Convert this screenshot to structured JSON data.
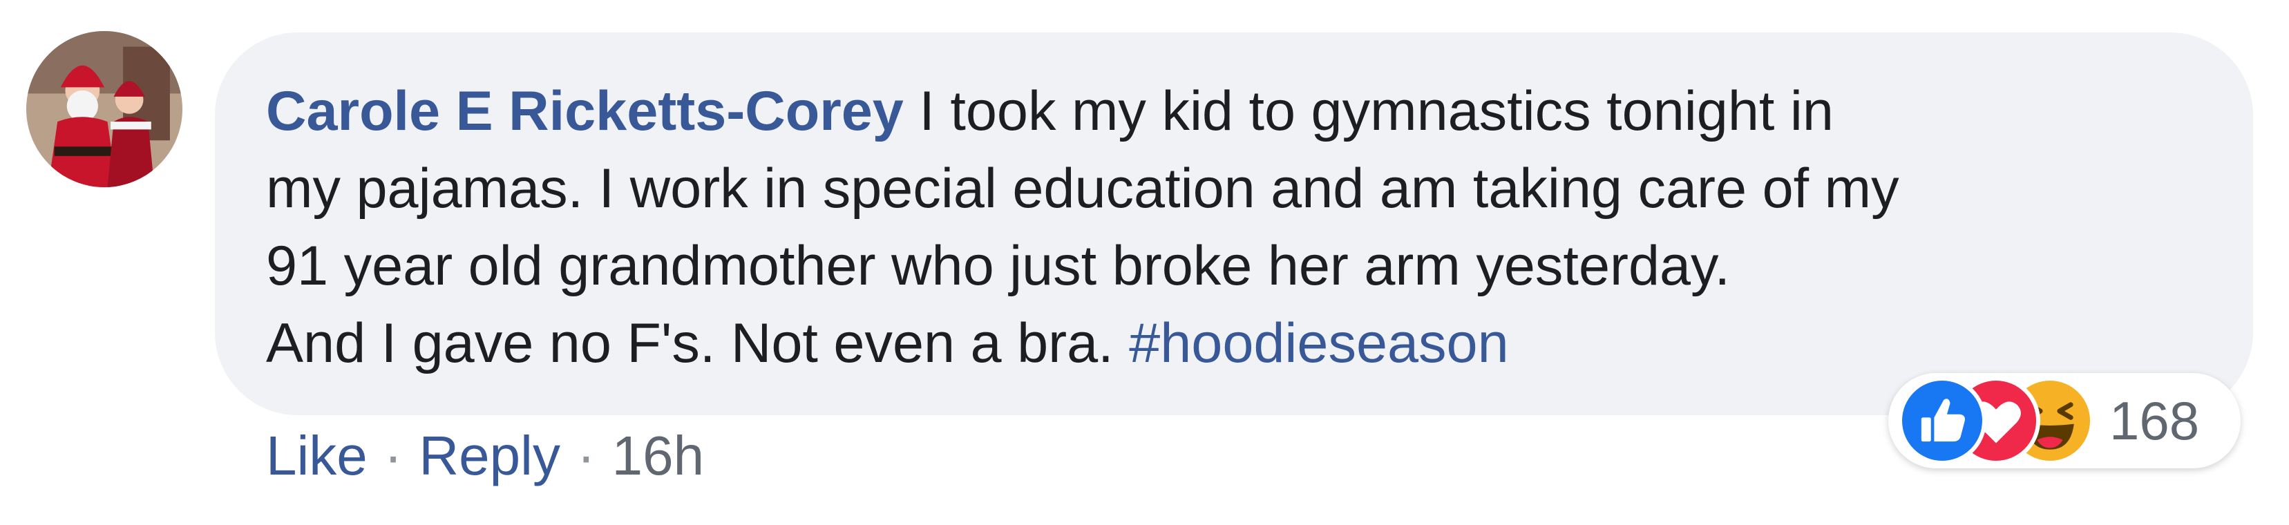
{
  "comment": {
    "avatar_icon": "santa-avatar-icon",
    "author": "Carole E Ricketts-Corey",
    "text_lines": [
      " I took my kid to gymnastics tonight in",
      "my pajamas. I work in special education and am taking care of my",
      "91 year old grandmother who just broke her arm yesterday.",
      "And I gave no F's. Not even a bra. "
    ],
    "hashtag": "#hoodieseason"
  },
  "actions": {
    "like_label": "Like",
    "separator": "·",
    "reply_label": "Reply",
    "timestamp": "16h"
  },
  "reactions": {
    "icons": [
      "like-reaction-icon",
      "love-reaction-icon",
      "haha-reaction-icon"
    ],
    "count": "168"
  },
  "colors": {
    "link_blue": "#385898",
    "bubble_bg": "#f0f2f5",
    "text": "#1c1e21",
    "meta_gray": "#606770",
    "like_blue": "#1877f2",
    "love_red": "#f0284a",
    "haha_yellow": "#f7b125"
  }
}
